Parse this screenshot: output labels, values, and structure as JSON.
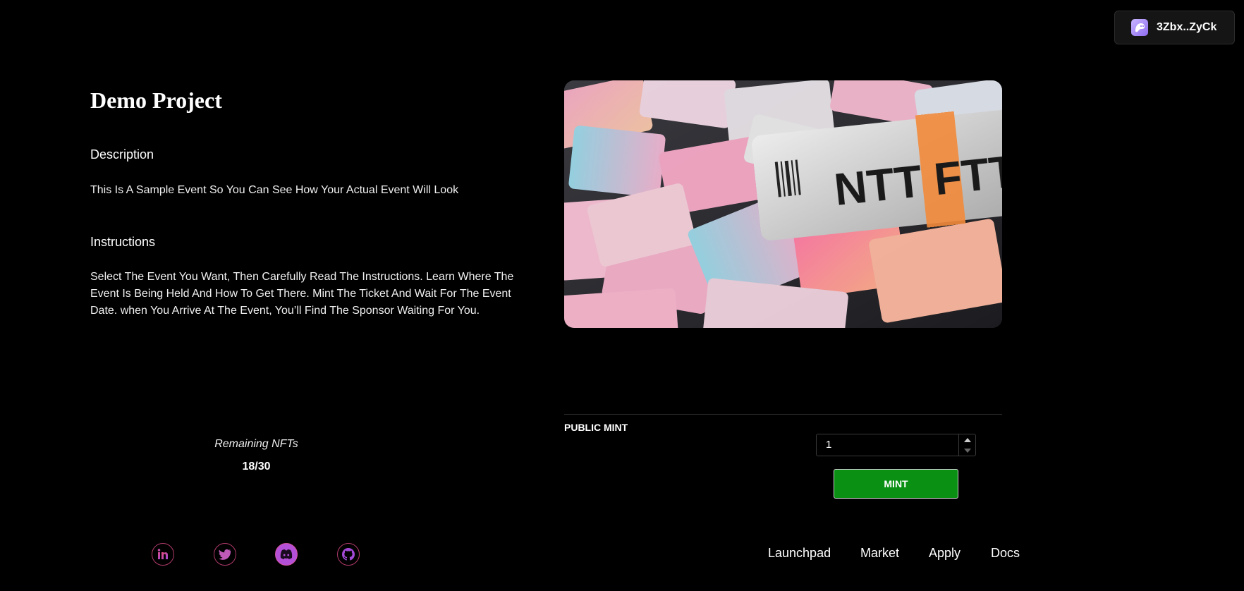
{
  "wallet": {
    "label": "3Zbx..ZyCk",
    "icon": "ghost-icon"
  },
  "project": {
    "title": "Demo Project",
    "description_heading": "Description",
    "description": "This Is A Sample Event So You Can See How Your Actual Event Will Look",
    "instructions_heading": "Instructions",
    "instructions": "Select The Event You Want, Then Carefully Read The Instructions. Learn Where The Event Is Being Held And How To Get There. Mint The Ticket And Wait For The Event Date. when You Arrive At The Event, You’ll Find The Sponsor Waiting For You."
  },
  "hero_image": {
    "ticket_text": "NTT FTT",
    "icon": "ticket-image"
  },
  "remaining": {
    "label": "Remaining NFTs",
    "value": "18/30"
  },
  "mint": {
    "section_label": "PUBLIC MINT",
    "quantity": "1",
    "button_label": "MINT",
    "button_color": "#0a9114"
  },
  "socials": [
    {
      "name": "linkedin-icon"
    },
    {
      "name": "twitter-icon"
    },
    {
      "name": "discord-icon"
    },
    {
      "name": "github-icon"
    }
  ],
  "footer_nav": [
    "Launchpad",
    "Market",
    "Apply",
    "Docs"
  ],
  "colors": {
    "background": "#000000",
    "accent_pink": "#d94a8c",
    "accent_purple": "#8e6cf0"
  }
}
